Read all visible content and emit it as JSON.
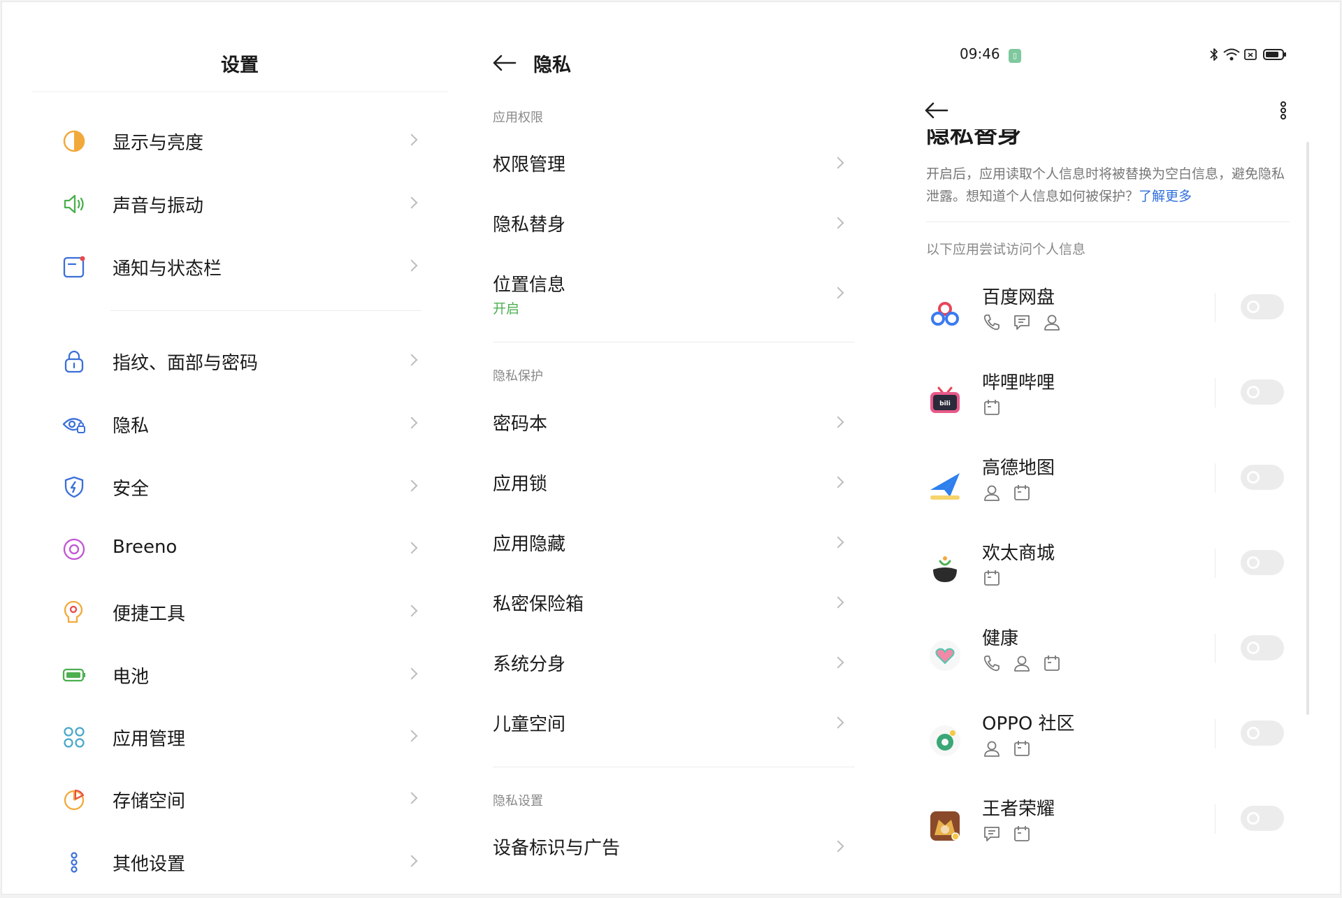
{
  "settings": {
    "title": "设置",
    "items": [
      {
        "label": "显示与亮度",
        "icon": "display-brightness-icon"
      },
      {
        "label": "声音与振动",
        "icon": "sound-vibration-icon"
      },
      {
        "label": "通知与状态栏",
        "icon": "notification-statusbar-icon"
      },
      {
        "label": "指纹、面部与密码",
        "icon": "lock-icon"
      },
      {
        "label": "隐私",
        "icon": "privacy-eye-icon"
      },
      {
        "label": "安全",
        "icon": "security-shield-icon"
      },
      {
        "label": "Breeno",
        "icon": "breeno-icon"
      },
      {
        "label": "便捷工具",
        "icon": "convenience-tools-icon"
      },
      {
        "label": "电池",
        "icon": "battery-icon"
      },
      {
        "label": "应用管理",
        "icon": "app-management-icon"
      },
      {
        "label": "存储空间",
        "icon": "storage-icon"
      },
      {
        "label": "其他设置",
        "icon": "other-settings-icon"
      }
    ]
  },
  "privacy": {
    "title": "隐私",
    "sections": [
      {
        "header": "应用权限",
        "items": [
          {
            "label": "权限管理",
            "sub": ""
          },
          {
            "label": "隐私替身",
            "sub": ""
          },
          {
            "label": "位置信息",
            "sub": "开启"
          }
        ]
      },
      {
        "header": "隐私保护",
        "items": [
          {
            "label": "密码本",
            "sub": ""
          },
          {
            "label": "应用锁",
            "sub": ""
          },
          {
            "label": "应用隐藏",
            "sub": ""
          },
          {
            "label": "私密保险箱",
            "sub": ""
          },
          {
            "label": "系统分身",
            "sub": ""
          },
          {
            "label": "儿童空间",
            "sub": ""
          }
        ]
      },
      {
        "header": "隐私设置",
        "items": [
          {
            "label": "设备标识与广告",
            "sub": ""
          }
        ]
      }
    ]
  },
  "detail": {
    "status_time": "09:46",
    "title_cut": "隐私替身",
    "description": "开启后，应用读取个人信息时将被替换为空白信息，避免隐私泄露。想知道个人信息如何被保护？",
    "learn_more": "了解更多",
    "list_hint": "以下应用尝试访问个人信息",
    "apps": [
      {
        "name": "百度网盘",
        "perms": [
          "phone",
          "message",
          "contact"
        ],
        "enabled": false
      },
      {
        "name": "哔哩哔哩",
        "perms": [
          "calendar"
        ],
        "enabled": false
      },
      {
        "name": "高德地图",
        "perms": [
          "contact",
          "calendar"
        ],
        "enabled": false
      },
      {
        "name": "欢太商城",
        "perms": [
          "calendar"
        ],
        "enabled": false
      },
      {
        "name": "健康",
        "perms": [
          "phone",
          "contact",
          "calendar"
        ],
        "enabled": false
      },
      {
        "name": "OPPO 社区",
        "perms": [
          "contact",
          "calendar"
        ],
        "enabled": false
      },
      {
        "name": "王者荣耀",
        "perms": [
          "message",
          "calendar"
        ],
        "enabled": false
      }
    ]
  },
  "colors": {
    "accent_blue": "#2e6fdc",
    "on_green": "#4caf50",
    "toggle_off": "#ececec"
  }
}
